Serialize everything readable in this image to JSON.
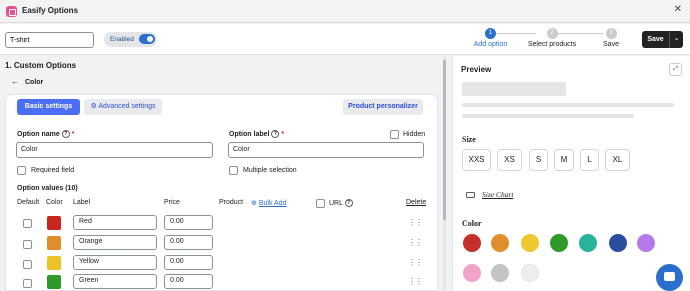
{
  "window": {
    "title": "Easify Options",
    "close_icon": "close-icon"
  },
  "topbar": {
    "option_set_name": "T-shirt",
    "status_label": "Enabled",
    "steps": [
      {
        "number": "1",
        "label": "Add option",
        "active": true
      },
      {
        "number": "2",
        "label": "Select products",
        "active": false
      },
      {
        "number": "3",
        "label": "Save",
        "active": false
      }
    ],
    "save_label": "Save",
    "save_more_glyph": "⌄"
  },
  "editor": {
    "section_title": "1. Custom Options",
    "back_arrow": "←",
    "current_option": "Color",
    "tabs": {
      "basic": "Basic settings",
      "advanced": "Advanced settings",
      "personalizer": "Product personalizer"
    },
    "option_name_label": "Option name",
    "option_name_value": "Color",
    "option_label_label": "Option label",
    "option_label_value": "Color",
    "hidden_label": "Hidden",
    "required_label": "Required field",
    "multiple_label": "Multiple selection",
    "values_title": "Option values (10)",
    "columns": {
      "default": "Default",
      "color": "Color",
      "label": "Label",
      "price": "Price",
      "product": "Product",
      "bulk_add": "Bulk Add",
      "url": "URL",
      "delete": "Delete"
    },
    "rows": [
      {
        "label": "Red",
        "price": "0.00",
        "color": "#c9271d"
      },
      {
        "label": "Orange",
        "price": "0.00",
        "color": "#e08d2b"
      },
      {
        "label": "Yellow",
        "price": "0.00",
        "color": "#edc226"
      },
      {
        "label": "Green",
        "price": "0.00",
        "color": "#2f9a2a"
      }
    ]
  },
  "preview": {
    "title": "Preview",
    "size_heading": "Size",
    "sizes": [
      "XXS",
      "XS",
      "S",
      "M",
      "L",
      "XL"
    ],
    "size_chart_label": "Size Chart",
    "color_heading": "Color",
    "colors": [
      "#c4302b",
      "#e08d2b",
      "#eec833",
      "#2f9a2a",
      "#26b49a",
      "#2a4f9e",
      "#b57ae8",
      "#f0a2c8",
      "#c4c4c4",
      "#eeeeee"
    ]
  },
  "colors": {
    "accent": "#4b6ef5",
    "primary": "#2c6ecb",
    "dark": "#202223"
  }
}
